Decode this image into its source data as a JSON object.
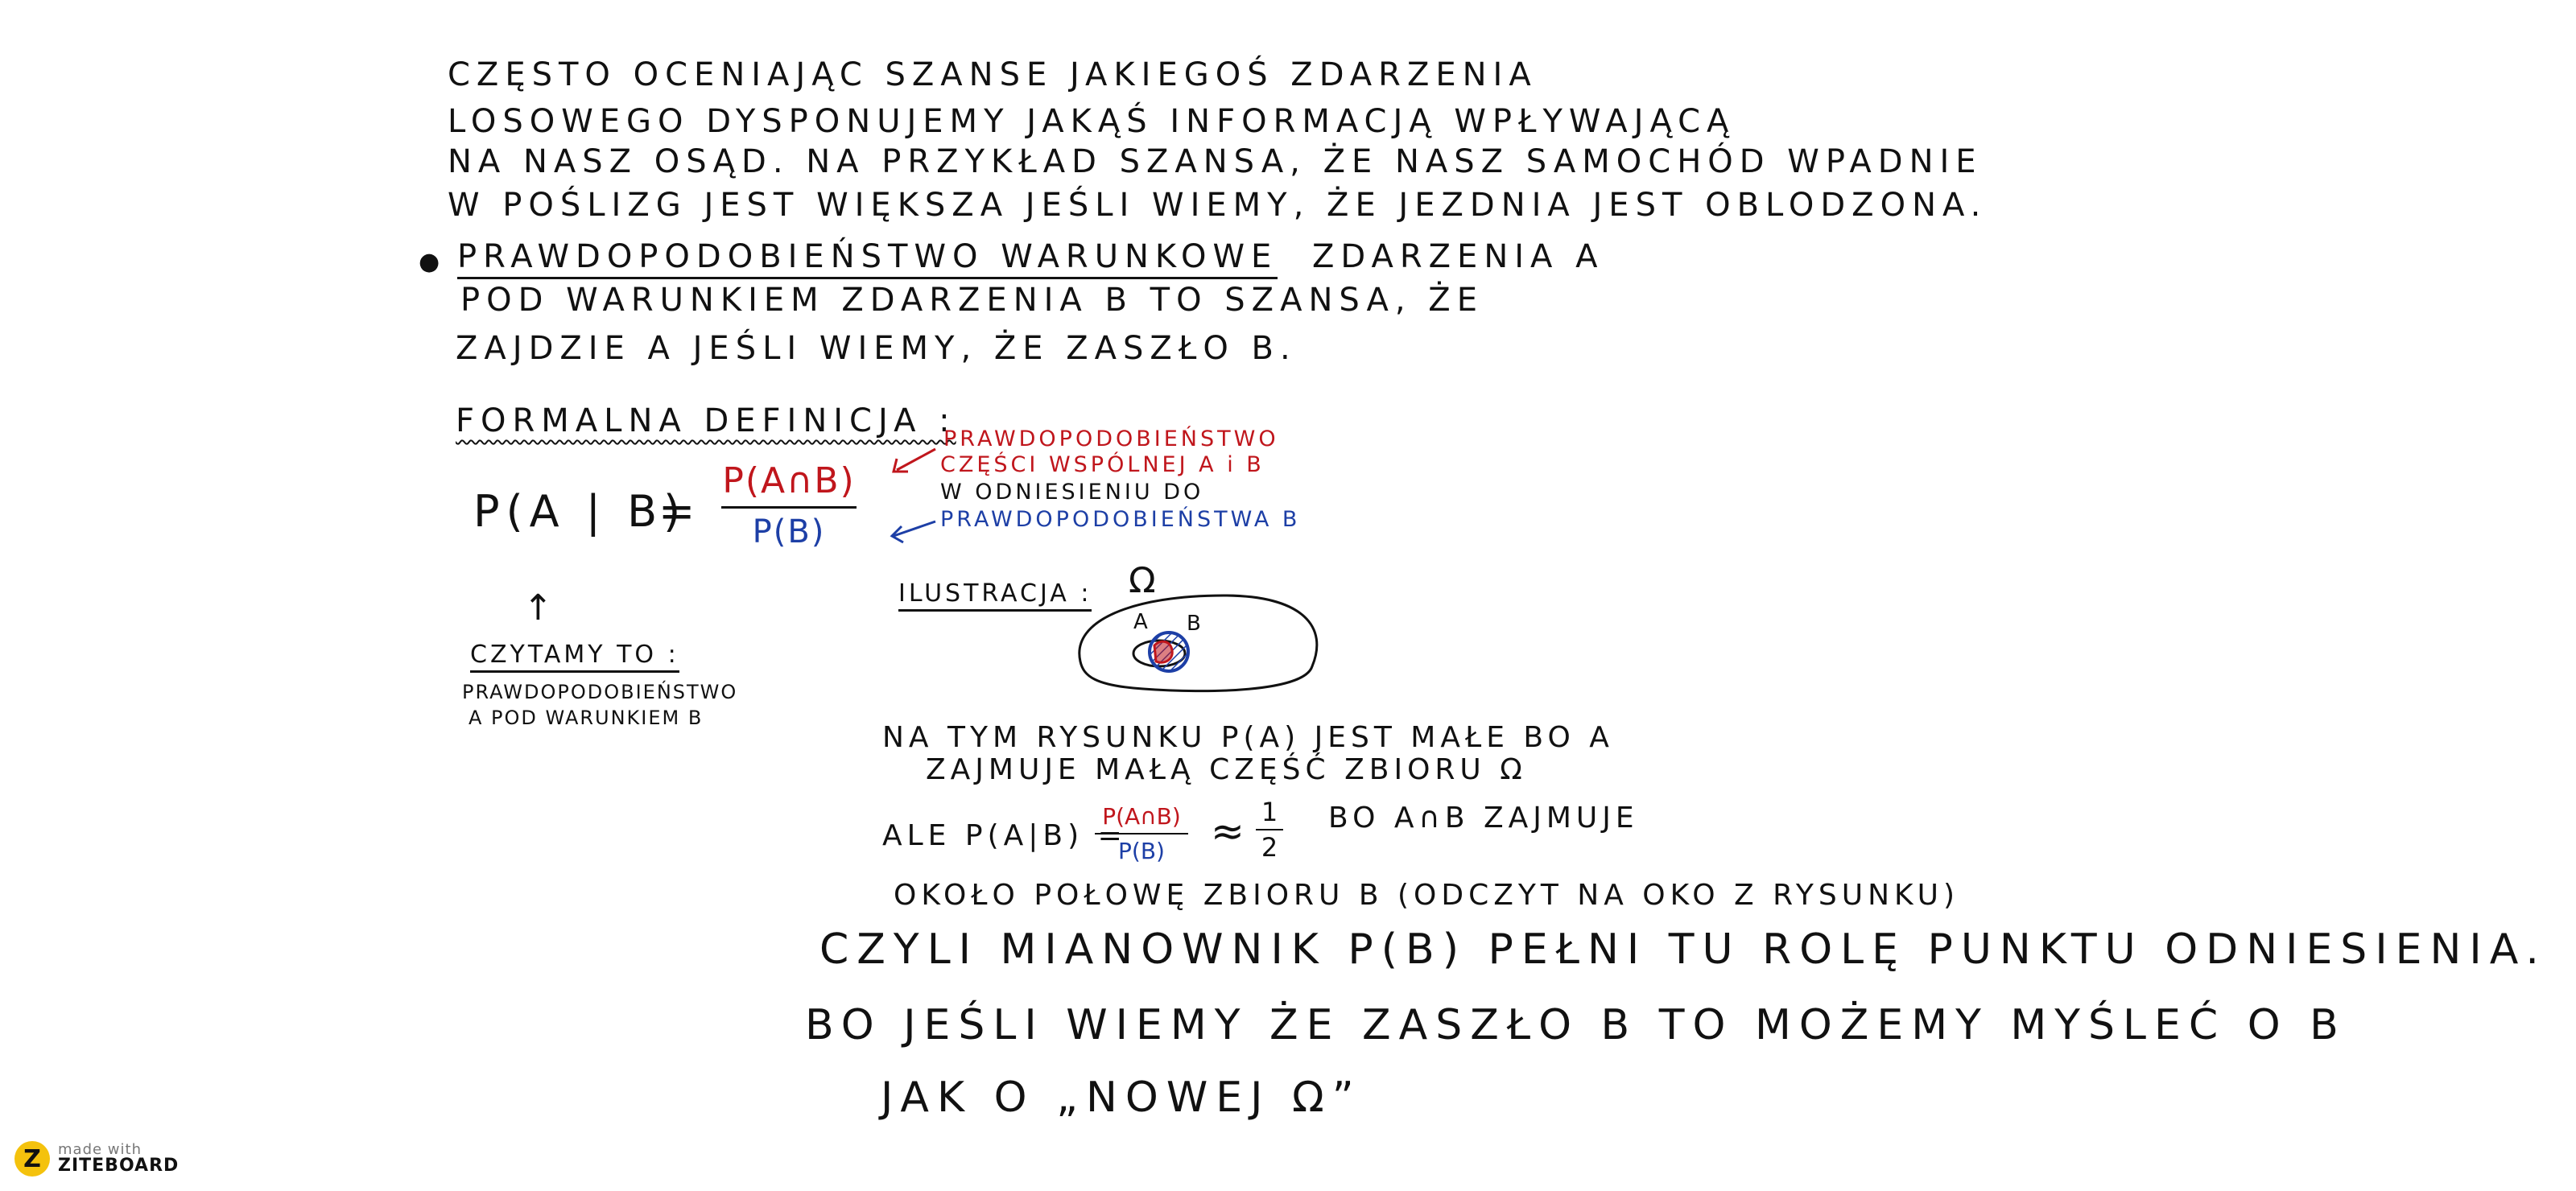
{
  "intro": [
    "CZĘSTO OCENIAJĄC SZANSE JAKIEGOŚ ZDARZENIA",
    "LOSOWEGO DYSPONUJEMY JAKĄŚ INFORMACJĄ WPŁYWAJĄCĄ",
    "NA NASZ OSĄD. NA PRZYKŁAD SZANSA, ŻE NASZ SAMOCHÓD WPADNIE",
    "W POŚLIZG JEST WIĘKSZA JEŚLI WIEMY, ŻE JEZDNIA JEST OBLODZONA."
  ],
  "definition": {
    "term": "PRAWDOPODOBIEŃSTWO WARUNKOWE",
    "line1_rest": "ZDARZENIA A",
    "line2": "POD WARUNKIEM ZDARZENIA B  TO SZANSA, ŻE",
    "line3": "ZAJDZIE A JEŚLI WIEMY, ŻE ZASZŁO B."
  },
  "formal": {
    "heading": "FORMALNA DEFINICJA :",
    "lhs": "P(A | B)",
    "equals": "=",
    "numerator": "P(A∩B)",
    "denominator": "P(B)",
    "note_red_1": "PRAWDOPODOBIEŃSTWO",
    "note_red_2": "CZĘŚCI WSPÓLNEJ A i B",
    "note_black": "W ODNIESIENIU DO",
    "note_blue": "PRAWDOPODOBIEŃSTWA B",
    "arrow_up": "↑",
    "read_heading": "CZYTAMY TO :",
    "read_1": "PRAWDOPODOBIEŃSTWO",
    "read_2": "A POD WARUNKIEM B"
  },
  "illustration": {
    "heading": "ILUSTRACJA :",
    "omega": "Ω",
    "label_a": "A",
    "label_b": "B",
    "colors": {
      "ellipse": "#111111",
      "set_a": "#c0161c",
      "set_b": "#1d3fa6"
    }
  },
  "explanation": {
    "line1": "NA TYM RYSUNKU P(A) JEST MAŁE BO A",
    "line2": "ZAJMUJE MAŁĄ CZĘŚĆ ZBIORU Ω",
    "ale": "ALE P(A|B) =",
    "frac_num": "P(A∩B)",
    "frac_den": "P(B)",
    "approx": "≈",
    "half_num": "1",
    "half_den": "2",
    "line3_rest": "BO A∩B ZAJMUJE",
    "line4": "OKOŁO POŁOWĘ ZBIORU B  (ODCZYT NA OKO Z RYSUNKU)"
  },
  "conclusion": {
    "line1": "CZYLI MIANOWNIK P(B) PEŁNI TU ROLĘ  PUNKTU ODNIESIENIA.",
    "line2": "BO JEŚLI WIEMY ŻE ZASZŁO B TO MOŻEMY MYŚLEĆ  O  B",
    "line3": "JAK O „NOWEJ Ω”"
  },
  "branding": {
    "mark": "Z",
    "made_with": "made with",
    "name": "ZITEBOARD",
    "color": "#f4c20d"
  }
}
